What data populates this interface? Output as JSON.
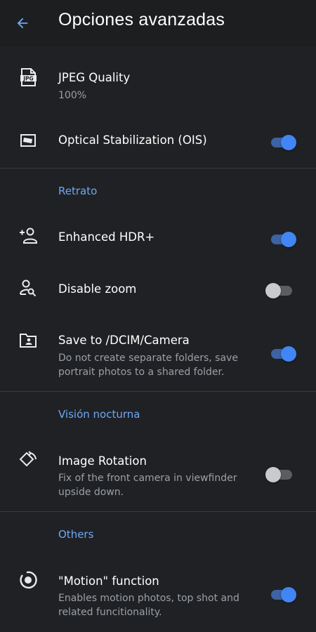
{
  "header": {
    "title": "Opciones avanzadas"
  },
  "colors": {
    "background": "#202124",
    "accent": "#4285f4",
    "section_header": "#6ea8f7"
  },
  "rows": {
    "jpeg_quality": {
      "title": "JPEG Quality",
      "subtitle": "100%",
      "icon": "jpeg-file-icon"
    },
    "ois": {
      "title": "Optical Stabilization (OIS)",
      "icon": "stabilization-icon",
      "toggle": "on"
    },
    "hdr": {
      "title": "Enhanced HDR+",
      "icon": "person-add-icon",
      "toggle": "on"
    },
    "zoom": {
      "title": "Disable zoom",
      "icon": "person-search-icon",
      "toggle": "off"
    },
    "save_dcim": {
      "title": "Save to /DCIM/Camera",
      "subtitle": "Do not create separate folders, save portrait photos to a shared folder.",
      "icon": "folder-person-icon",
      "toggle": "on"
    },
    "rotation": {
      "title": "Image Rotation",
      "subtitle": "Fix of the front camera in viewfinder upside down.",
      "icon": "rotate-icon",
      "toggle": "off"
    },
    "motion": {
      "title": "\"Motion\" function",
      "subtitle": "Enables motion photos, top shot and related funcitionality.",
      "icon": "motion-icon",
      "toggle": "on"
    }
  },
  "sections": {
    "portrait": "Retrato",
    "night": "Visión nocturna",
    "others": "Others"
  }
}
